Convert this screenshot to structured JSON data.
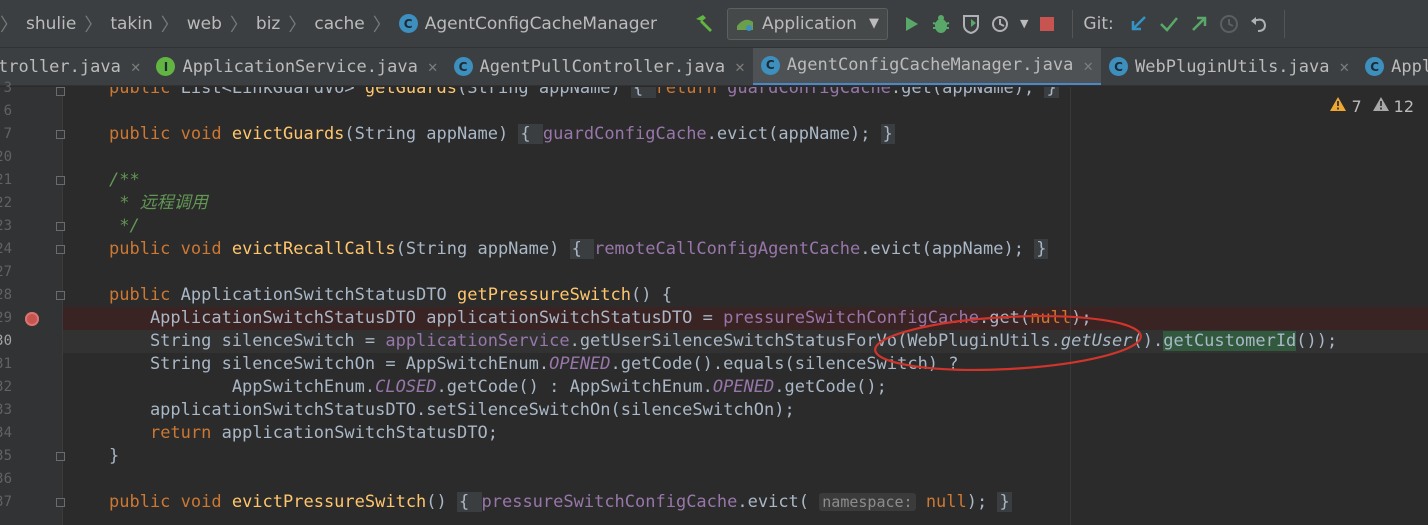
{
  "navbar": {
    "breadcrumbs": [
      "shulie",
      "takin",
      "web",
      "biz",
      "cache"
    ],
    "current_class": "AgentConfigCacheManager",
    "run_config": "Application",
    "git_label": "Git:",
    "icons": [
      "hammer-icon",
      "run-icon",
      "debug-icon",
      "coverage-icon",
      "profile-icon",
      "stop-icon",
      "git-update-icon",
      "git-commit-icon",
      "git-push-icon",
      "history-icon",
      "rollback-icon"
    ]
  },
  "tabs": [
    {
      "label": "troller.java",
      "icon": "",
      "active": false
    },
    {
      "label": "ApplicationService.java",
      "icon": "I",
      "active": false
    },
    {
      "label": "AgentPullController.java",
      "icon": "C",
      "active": false
    },
    {
      "label": "AgentConfigCacheManager.java",
      "icon": "C",
      "active": true
    },
    {
      "label": "WebPluginUtils.java",
      "icon": "C",
      "active": false
    },
    {
      "label": "Appli",
      "icon": "C",
      "active": false
    }
  ],
  "status": {
    "warning_count": "7",
    "weak_warning_count": "12",
    "warning_color": "#f0a732",
    "weak_warning_color": "#a8a8a8"
  },
  "gutter": {
    "line_numbers": [
      "3",
      "6",
      "7",
      "20",
      "21",
      "22",
      "23",
      "24",
      "27",
      "28",
      "29",
      "30",
      "31",
      "32",
      "33",
      "34",
      "35",
      "36",
      "37"
    ]
  },
  "code": {
    "l0": {
      "a": "public ",
      "b": "List<LinkGuardVo> ",
      "c": "getGuards",
      "d": "(String appName) ",
      "e": "{ ",
      "f": "return ",
      "g": "guardConfigCache",
      "h": ".get(appName); ",
      "i": "}"
    },
    "l2": {
      "a": "public void ",
      "b": "evictGuards",
      "c": "(String appName) ",
      "d": "{ ",
      "e": "guardConfigCache",
      "f": ".evict(appName); ",
      "g": "}"
    },
    "l4": {
      "a": "/**"
    },
    "l5": {
      "a": " * ",
      "b": "远程调用"
    },
    "l6": {
      "a": " */"
    },
    "l7": {
      "a": "public void ",
      "b": "evictRecallCalls",
      "c": "(String appName) ",
      "d": "{ ",
      "e": "remoteCallConfigAgentCache",
      "f": ".evict(appName); ",
      "g": "}"
    },
    "l9": {
      "a": "public ",
      "b": "ApplicationSwitchStatusDTO ",
      "c": "getPressureSwitch",
      "d": "() {"
    },
    "l10": {
      "a": "    ApplicationSwitchStatusDTO applicationSwitchStatusDTO = ",
      "b": "pressureSwitchConfigCache",
      "c": ".get(",
      "d": "null",
      "e": ");"
    },
    "l11": {
      "a": "    String silenceSwitch = ",
      "b": "applicationService",
      "c": ".getUserSilenceSwitchStatusForVo(WebPluginUtils.",
      "d": "getUser",
      "e": "().",
      "f": "getCustomerId",
      "g": "());"
    },
    "l12": {
      "a": "    String silenceSwitchOn = AppSwitchEnum.",
      "b": "OPENED",
      "c": ".getCode().equals(silenceSwitch) ?"
    },
    "l13": {
      "a": "            AppSwitchEnum.",
      "b": "CLOSED",
      "c": ".getCode() : AppSwitchEnum.",
      "d": "OPENED",
      "e": ".getCode();"
    },
    "l14": {
      "a": "    applicationSwitchStatusDTO.setSilenceSwitchOn(silenceSwitchOn);"
    },
    "l15": {
      "a": "    ",
      "b": "return ",
      "c": "applicationSwitchStatusDTO;"
    },
    "l16": {
      "a": "}"
    },
    "l18": {
      "a": "public void ",
      "b": "evictPressureSwitch",
      "c": "() ",
      "d": "{ ",
      "e": "pressureSwitchConfigCache",
      "f": ".evict( ",
      "g": "namespace:",
      "h": " null",
      "i": "); ",
      "j": "}"
    }
  }
}
